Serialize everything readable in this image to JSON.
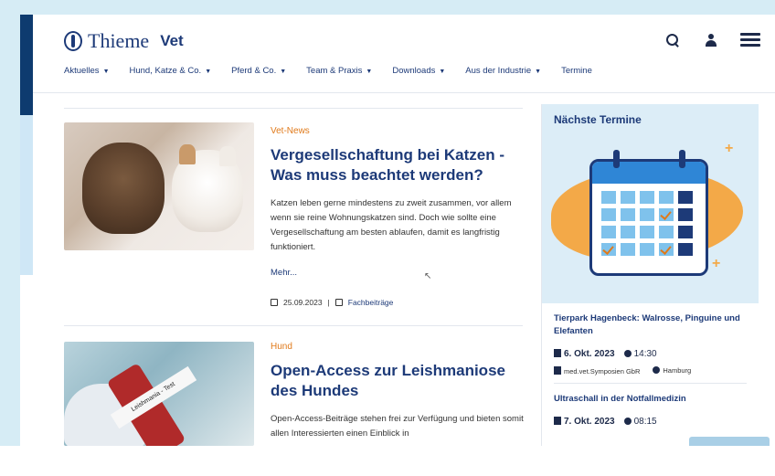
{
  "header": {
    "brand": "Thieme",
    "brand_sub": "Vet",
    "nav": [
      {
        "label": "Aktuelles",
        "has_caret": true
      },
      {
        "label": "Hund, Katze & Co.",
        "has_caret": true
      },
      {
        "label": "Pferd & Co.",
        "has_caret": true
      },
      {
        "label": "Team & Praxis",
        "has_caret": true
      },
      {
        "label": "Downloads",
        "has_caret": true
      },
      {
        "label": "Aus der Industrie",
        "has_caret": true
      },
      {
        "label": "Termine",
        "has_caret": false
      }
    ]
  },
  "articles": [
    {
      "category": "Vet-News",
      "title": "Vergesellschaftung bei Katzen - Was muss beachtet werden?",
      "body": "Katzen leben gerne mindestens zu zweit zusammen, vor allem wenn sie reine Wohnungskatzen sind. Doch wie sollte eine Vergesellschaftung am besten ablaufen, damit es langfristig funktioniert.",
      "more": "Mehr...",
      "date": "25.09.2023",
      "tag": "Fachbeiträge"
    },
    {
      "category": "Hund",
      "title": "Open-Access zur Leishmaniose des Hundes",
      "body": "Open-Access-Beiträge stehen frei zur Verfügung und bieten somit allen Interessierten einen Einblick in",
      "image_text": "Leishmania - Test"
    }
  ],
  "sidebar": {
    "title": "Nächste Termine",
    "events": [
      {
        "title": "Tierpark Hagenbeck: Walrosse, Pinguine und Elefanten",
        "date": "6. Okt. 2023",
        "time": "14:30",
        "organizer": "med.vet.Symposien GbR",
        "location": "Hamburg"
      },
      {
        "title": "Ultraschall in der Notfallmedizin",
        "date": "7. Okt. 2023",
        "time": "08:15"
      }
    ]
  },
  "colors": {
    "accent": "#e07a1b",
    "brand": "#1d3a78",
    "background": "#d6ecf5"
  }
}
